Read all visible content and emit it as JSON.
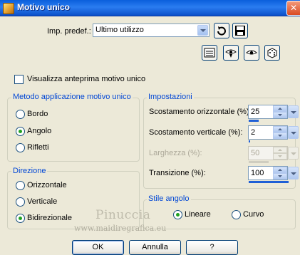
{
  "window": {
    "title": "Motivo unico",
    "close": "✕"
  },
  "preset": {
    "label": "Imp. predef.:",
    "value": "Ultimo utilizzo"
  },
  "preview": {
    "label": "Visualizza anteprima motivo unico",
    "checked": false
  },
  "method_group": {
    "title": "Metodo applicazione motivo unico",
    "options": [
      "Bordo",
      "Angolo",
      "Rifletti"
    ],
    "selected": "Angolo"
  },
  "direction_group": {
    "title": "Direzione",
    "options": [
      "Orizzontale",
      "Verticale",
      "Bidirezionale"
    ],
    "selected": "Bidirezionale"
  },
  "settings_group": {
    "title": "Impostazioni",
    "fields": [
      {
        "label": "Scostamento orizzontale (%):",
        "value": "25",
        "level": 0.25,
        "enabled": true
      },
      {
        "label": "Scostamento verticale (%):",
        "value": "2",
        "level": 0.02,
        "enabled": true
      },
      {
        "label": "Larghezza (%):",
        "value": "50",
        "level": 0.5,
        "enabled": false
      },
      {
        "label": "Transizione (%):",
        "value": "100",
        "level": 1.0,
        "enabled": true
      }
    ]
  },
  "corner_group": {
    "title": "Stile angolo",
    "options": [
      "Lineare",
      "Curvo"
    ],
    "selected": "Lineare"
  },
  "buttons": {
    "ok": "OK",
    "cancel": "Annulla",
    "help": "?"
  },
  "watermark": {
    "line1": "Pinuccia",
    "line2": "www.maidiregrafica.eu"
  },
  "colors": {
    "titlebar": "#0a5fdc",
    "group_title": "#0046d5",
    "radio_dot": "#21a121",
    "background": "#ece9d8"
  },
  "icons": [
    "app-icon",
    "reset-icon",
    "save-preset-icon",
    "randomize-icon",
    "preview-eye-icon",
    "proof-eye-icon",
    "dice-icon"
  ]
}
